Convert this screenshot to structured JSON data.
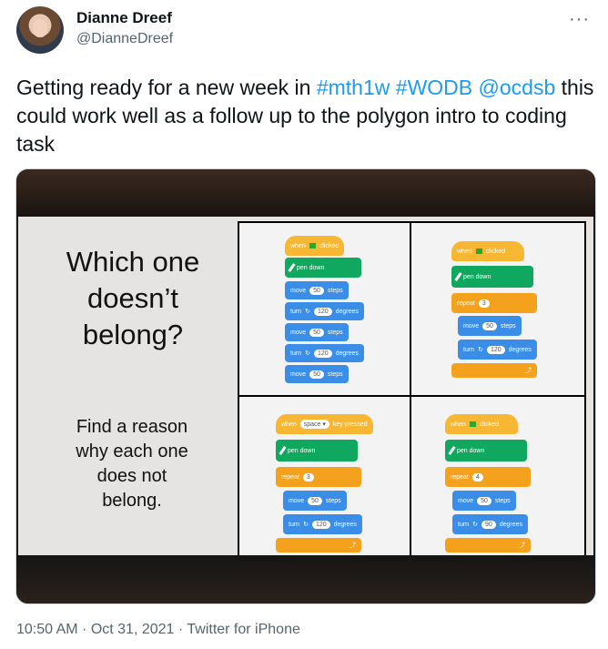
{
  "author": {
    "name": "Dianne Dreef",
    "handle": "@DianneDreef"
  },
  "more_label": "···",
  "tweet": {
    "part1": "Getting ready for a new week in ",
    "tag1": "#mth1w",
    "space1": " ",
    "tag2": "#WODB",
    "space2": " ",
    "tag3": "@ocdsb",
    "part2": " this could work well as a follow up to the polygon intro to coding task"
  },
  "image": {
    "question_lines": [
      "Which one",
      "doesn’t",
      "belong?"
    ],
    "reason_lines": [
      "Find a reason",
      "why each one",
      "does not",
      "belong."
    ],
    "panels": {
      "tl": {
        "when": "when",
        "clicked": "clicked",
        "pen": "pen down",
        "rows": [
          {
            "a": "move",
            "v": "50",
            "b": "steps"
          },
          {
            "a": "turn",
            "v": "120",
            "b": "degrees"
          },
          {
            "a": "move",
            "v": "50",
            "b": "steps"
          },
          {
            "a": "turn",
            "v": "120",
            "b": "degrees"
          },
          {
            "a": "move",
            "v": "50",
            "b": "steps"
          }
        ]
      },
      "tr": {
        "when": "when",
        "clicked": "clicked",
        "pen": "pen down",
        "repeat": "repeat",
        "times": "3",
        "move": "move",
        "steps_v": "50",
        "steps": "steps",
        "turn": "turn",
        "deg_v": "120",
        "deg": "degrees"
      },
      "bl": {
        "when": "when",
        "key": "space ▾",
        "pressed": "key pressed",
        "pen": "pen down",
        "repeat": "repeat",
        "times": "3",
        "move": "move",
        "steps_v": "50",
        "steps": "steps",
        "turn": "turn",
        "deg_v": "120",
        "deg": "degrees"
      },
      "br": {
        "when": "when",
        "clicked": "clicked",
        "pen": "pen down",
        "repeat": "repeat",
        "times": "4",
        "move": "move",
        "steps_v": "50",
        "steps": "steps",
        "turn": "turn",
        "deg_v": "90",
        "deg": "degrees"
      }
    }
  },
  "timestamp": "10:50 AM · Oct 31, 2021 · Twitter for iPhone"
}
